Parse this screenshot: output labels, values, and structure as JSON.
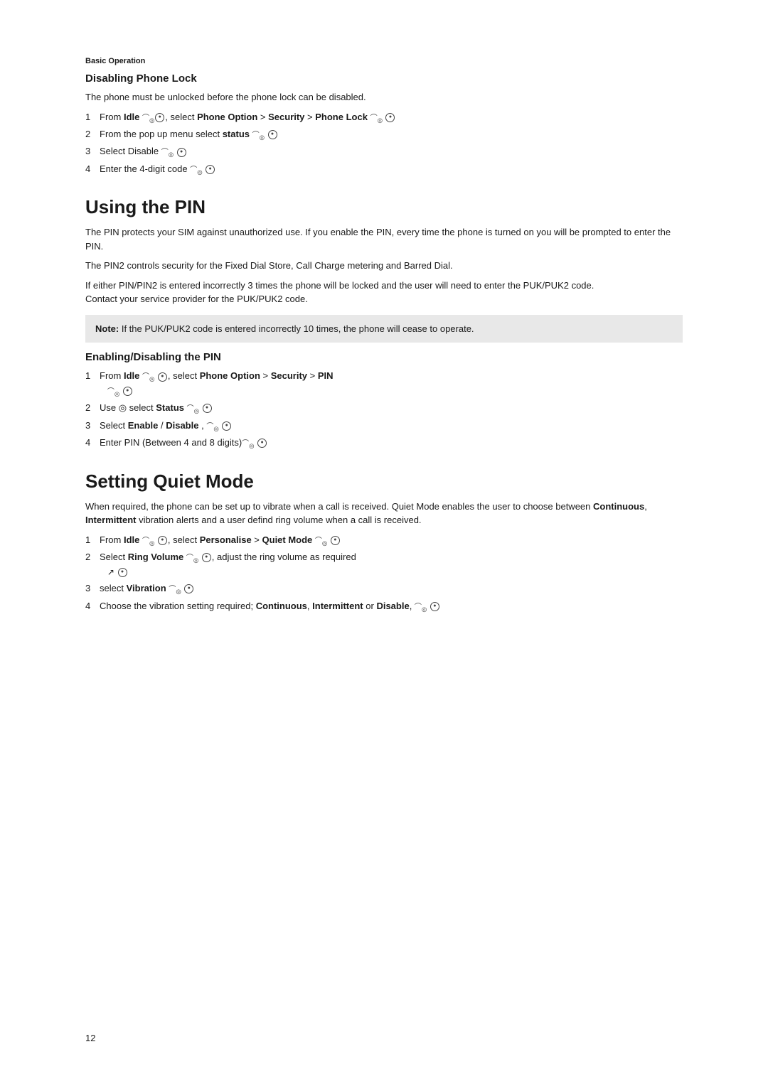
{
  "page": {
    "number": "12",
    "section_label": "Basic Operation",
    "disabling_phone_lock": {
      "title": "Disabling Phone Lock",
      "intro": "The phone must be unlocked before the phone lock can be disabled.",
      "steps": [
        {
          "num": "1",
          "text": "From Idle , select Phone Option > Security > Phone Lock "
        },
        {
          "num": "2",
          "text": "From the pop up menu select status "
        },
        {
          "num": "3",
          "text": "Select Disable "
        },
        {
          "num": "4",
          "text": "Enter the 4-digit code "
        }
      ]
    },
    "using_the_pin": {
      "title": "Using the PIN",
      "para1": "The PIN protects your SIM against unauthorized use. If you enable the PIN, every time the phone is turned on you will be prompted to enter the PIN.",
      "para2": "The PIN2 controls security for the Fixed Dial Store, Call Charge metering and Barred Dial.",
      "para3": "If either PIN/PIN2 is entered incorrectly 3 times the phone will be locked and the user will need to enter the PUK/PUK2 code.\nContact your service provider for the PUK/PUK2 code.",
      "note": "Note: If the PUK/PUK2 code is entered incorrectly 10 times, the phone will cease to operate.",
      "enabling_title": "Enabling/Disabling the PIN",
      "steps": [
        {
          "num": "1",
          "text": "From Idle , select Phone Option > Security > PIN "
        },
        {
          "num": "2",
          "text": "Use select Status "
        },
        {
          "num": "3",
          "text": "Select Enable / Disable , "
        },
        {
          "num": "4",
          "text": "Enter PIN (Between 4 and 8 digits) "
        }
      ]
    },
    "setting_quiet_mode": {
      "title": "Setting Quiet Mode",
      "para1": "When required, the phone can be set up to vibrate when a call is received. Quiet Mode enables the user to choose between Continuous, Intermittent vibration alerts and a user defind ring volume when a call is received.",
      "steps": [
        {
          "num": "1",
          "text": "From Idle , select Personalise > Quiet Mode "
        },
        {
          "num": "2",
          "text": "Select Ring Volume , adjust the ring volume as required "
        },
        {
          "num": "3",
          "text": "select Vibration "
        },
        {
          "num": "4",
          "text": "Choose the vibration setting required; Continuous, Intermittent or Disable, "
        }
      ]
    }
  }
}
